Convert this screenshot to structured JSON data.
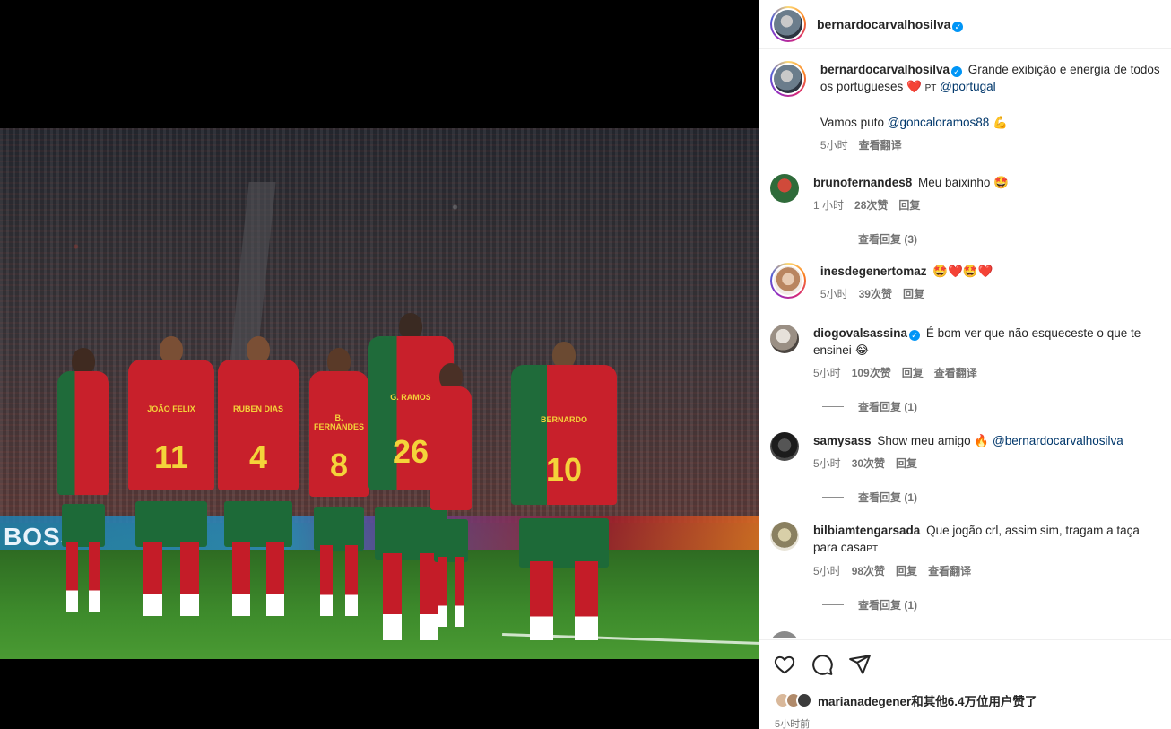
{
  "media": {
    "ad_text": "BOSS",
    "players": [
      {
        "name": "JOÃO FELIX",
        "number": "11"
      },
      {
        "name": "RUBEN DIAS",
        "number": "4"
      },
      {
        "name": "B. FERNANDES",
        "number": "8"
      },
      {
        "name": "G. RAMOS",
        "number": "26"
      },
      {
        "name": "BERNARDO",
        "number": "10"
      }
    ]
  },
  "header": {
    "username": "bernardocarvalhosilva",
    "verified_badge": "✓"
  },
  "caption": {
    "username": "bernardocarvalhosilva",
    "text1": "Grande exibição e energia de todos os portugueses",
    "emoji1": "❤️",
    "flag": "PT",
    "mention1": "@portugal",
    "line2_text": "Vamos puto",
    "mention2": "@goncaloramos88",
    "emoji2": "💪",
    "time": "5小时",
    "translate": "查看翻译"
  },
  "comments": [
    {
      "username": "brunofernandes8",
      "text": "Meu baixinho",
      "emoji": "🤩",
      "time": "1 小时",
      "likes": "28次赞",
      "reply": "回复",
      "view_replies": "查看回复 (3)"
    },
    {
      "username": "inesdegenertomaz",
      "text": "",
      "emoji": "🤩❤️🤩❤️",
      "time": "5小时",
      "likes": "39次赞",
      "reply": "回复"
    },
    {
      "username": "diogovalsassina",
      "text": "É bom ver que não esqueceste o que te ensinei",
      "emoji": "😂",
      "time": "5小时",
      "likes": "109次赞",
      "reply": "回复",
      "translate": "查看翻译",
      "view_replies": "查看回复 (1)"
    },
    {
      "username": "samysass",
      "text": "Show meu amigo",
      "emoji": "🔥",
      "mention": "@bernardocarvalhosilva",
      "time": "5小时",
      "likes": "30次赞",
      "reply": "回复",
      "view_replies": "查看回复 (1)"
    },
    {
      "username": "bilbiamtengarsada",
      "text": "Que jogão crl, assim sim, tragam a taça para casa",
      "flag": "PT",
      "time": "5小时",
      "likes": "98次赞",
      "reply": "回复",
      "translate": "查看翻译",
      "view_replies": "查看回复 (1)"
    }
  ],
  "footer": {
    "likes_text": "marianadegener和其他6.4万位用户赞了",
    "post_time": "5小时前"
  },
  "icons": [
    "heart-icon",
    "comment-icon",
    "share-icon",
    "verified-icon"
  ],
  "colors": {
    "link": "#00376b",
    "verified": "#0095f6",
    "muted": "#737373"
  }
}
